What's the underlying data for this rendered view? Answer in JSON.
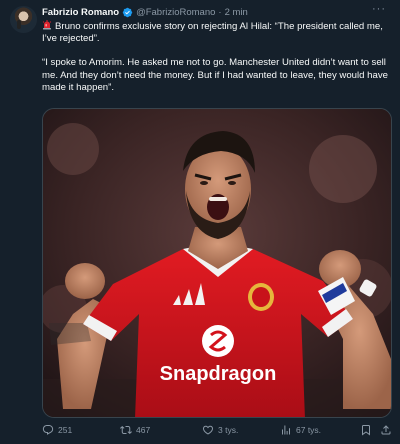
{
  "author": {
    "name": "Fabrizio Romano",
    "handle": "@FabrizioRomano",
    "separator": "·",
    "time": "2 min",
    "verified_color": "#1d9bf0"
  },
  "more_label": "···",
  "tweet": {
    "emoji": "siren-icon",
    "paragraph1": "Bruno confirms exclusive story on rejecting Al Hilal: “The president called me, I’ve rejected”.",
    "paragraph2": "“I spoke to Amorim. He asked me not to go. Manchester United didn’t want to sell me. And they don’t need the money. But if I had wanted to leave, they would have made it happen”."
  },
  "media": {
    "sponsor": "Snapdragon",
    "shirt_color": "#d3121b"
  },
  "actions": {
    "replies": "251",
    "reposts": "467",
    "likes": "3 tys.",
    "views": "67 tys."
  },
  "colors": {
    "background": "#15202b",
    "muted": "#8b98a5",
    "text": "#f7f9f9"
  }
}
